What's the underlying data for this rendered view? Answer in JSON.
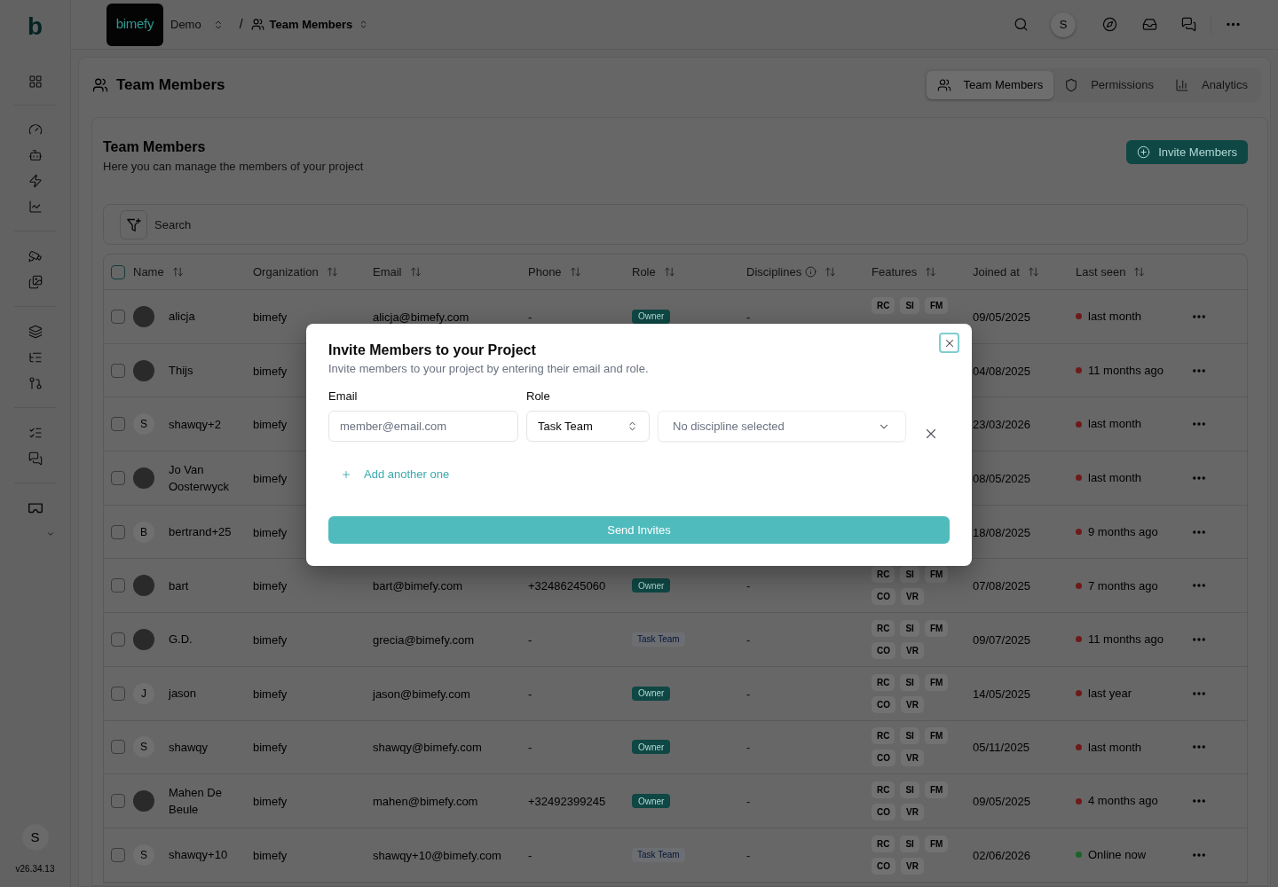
{
  "sidebar": {
    "logo": "b",
    "avatar": "S",
    "version": "v26.34.13"
  },
  "topbar": {
    "brand": "bimefy",
    "breadcrumbs": [
      {
        "label": "Demo",
        "kind": "workspace"
      },
      {
        "label": "Team Members",
        "kind": "page"
      }
    ],
    "separator": "/",
    "avatar": "S"
  },
  "page": {
    "title": "Team Members",
    "tabs": [
      {
        "label": "Team Members",
        "selected": true
      },
      {
        "label": "Permissions",
        "selected": false
      },
      {
        "label": "Analytics",
        "selected": false
      }
    ]
  },
  "members": {
    "title": "Team Members",
    "subtitle": "Here you can manage the members of your project",
    "invite_button": "Invite Members",
    "search": {
      "placeholder": "Search"
    }
  },
  "table": {
    "all_checked": false,
    "columns": [
      {
        "label": "Name"
      },
      {
        "label": "Organization"
      },
      {
        "label": "Email"
      },
      {
        "label": "Phone"
      },
      {
        "label": "Role"
      },
      {
        "label": "Disciplines",
        "info": true
      },
      {
        "label": "Features"
      },
      {
        "label": "Joined at"
      },
      {
        "label": "Last seen"
      }
    ],
    "rows": [
      {
        "checked": false,
        "avatar": {
          "kind": "photo"
        },
        "name": "alicja",
        "organization": "bimefy",
        "email": "alicja@bimefy.com",
        "phone": "-",
        "role": {
          "label": "Owner",
          "kind": "owner"
        },
        "disciplines": "-",
        "features": [
          "RC",
          "SI",
          "FM"
        ],
        "joined": "09/05/2025",
        "last_seen": {
          "label": "last month",
          "color": "#6e1a1a"
        }
      },
      {
        "checked": false,
        "avatar": {
          "kind": "photo"
        },
        "name": "Thijs",
        "organization": "bimefy",
        "joined": "04/08/2025",
        "last_seen": {
          "label": "11 months ago",
          "color": "#6e1a1a"
        }
      },
      {
        "checked": false,
        "avatar": {
          "kind": "initial",
          "initial": "S"
        },
        "name": "shawqy+2",
        "organization": "bimefy",
        "joined": "23/03/2026",
        "last_seen": {
          "label": "last month",
          "color": "#6e1a1a"
        }
      },
      {
        "checked": false,
        "avatar": {
          "kind": "photo"
        },
        "name": "Jo Van Oosterwyck",
        "organization": "bimefy",
        "joined": "08/05/2025",
        "last_seen": {
          "label": "last month",
          "color": "#6e1a1a"
        }
      },
      {
        "checked": false,
        "avatar": {
          "kind": "initial",
          "initial": "B"
        },
        "name": "bertrand+25",
        "organization": "bimefy",
        "joined": "18/08/2025",
        "last_seen": {
          "label": "9 months ago",
          "color": "#6e1a1a"
        }
      },
      {
        "checked": false,
        "avatar": {
          "kind": "photo"
        },
        "name": "bart",
        "organization": "bimefy",
        "email": "bart@bimefy.com",
        "phone": "+32486245060",
        "role": {
          "label": "Owner",
          "kind": "owner"
        },
        "disciplines": "-",
        "features": [
          "RC",
          "SI",
          "FM",
          "CO",
          "VR"
        ],
        "joined": "07/08/2025",
        "last_seen": {
          "label": "7 months ago",
          "color": "#6e1a1a"
        }
      },
      {
        "checked": false,
        "avatar": {
          "kind": "photo"
        },
        "name": "G.D.",
        "organization": "bimefy",
        "email": "grecia@bimefy.com",
        "phone": "-",
        "role": {
          "label": "Task Team",
          "kind": "task"
        },
        "disciplines": "-",
        "features": [
          "RC",
          "SI",
          "FM",
          "CO",
          "VR"
        ],
        "joined": "09/07/2025",
        "last_seen": {
          "label": "11 months ago",
          "color": "#6e1a1a"
        }
      },
      {
        "checked": false,
        "avatar": {
          "kind": "initial",
          "initial": "J"
        },
        "name": "jason",
        "organization": "bimefy",
        "email": "jason@bimefy.com",
        "phone": "-",
        "role": {
          "label": "Owner",
          "kind": "owner"
        },
        "disciplines": "-",
        "features": [
          "RC",
          "SI",
          "FM",
          "CO",
          "VR"
        ],
        "joined": "14/05/2025",
        "last_seen": {
          "label": "last year",
          "color": "#6e1a1a"
        }
      },
      {
        "checked": false,
        "avatar": {
          "kind": "initial",
          "initial": "S"
        },
        "name": "shawqy",
        "organization": "bimefy",
        "email": "shawqy@bimefy.com",
        "phone": "-",
        "role": {
          "label": "Owner",
          "kind": "owner"
        },
        "disciplines": "-",
        "features": [
          "RC",
          "SI",
          "FM",
          "CO",
          "VR"
        ],
        "joined": "05/11/2025",
        "last_seen": {
          "label": "last month",
          "color": "#6e1a1a"
        }
      },
      {
        "checked": false,
        "avatar": {
          "kind": "photo"
        },
        "name": "Mahen De Beule",
        "organization": "bimefy",
        "email": "mahen@bimefy.com",
        "phone": "+32492399245",
        "role": {
          "label": "Owner",
          "kind": "owner"
        },
        "disciplines": "-",
        "features": [
          "RC",
          "SI",
          "FM",
          "CO",
          "VR"
        ],
        "joined": "09/05/2025",
        "last_seen": {
          "label": "4 months ago",
          "color": "#6e1a1a"
        }
      },
      {
        "checked": false,
        "avatar": {
          "kind": "initial",
          "initial": "S"
        },
        "name": "shawqy+10",
        "organization": "bimefy",
        "email": "shawqy+10@bimefy.com",
        "phone": "-",
        "role": {
          "label": "Task Team",
          "kind": "task"
        },
        "disciplines": "-",
        "features": [
          "RC",
          "SI",
          "FM",
          "CO",
          "VR"
        ],
        "joined": "02/06/2026",
        "last_seen": {
          "label": "Online now",
          "color": "#1c6428"
        }
      }
    ]
  },
  "dialog": {
    "title": "Invite Members to your Project",
    "description": "Invite members to your project by entering their email and role.",
    "email_label": "Email",
    "role_label": "Role",
    "invites": [
      {
        "email": {
          "placeholder": "member@email.com"
        },
        "role": "Task Team",
        "discipline": {
          "placeholder": "No discipline selected"
        }
      }
    ],
    "add_link": "Add another one",
    "submit": "Send Invites"
  }
}
